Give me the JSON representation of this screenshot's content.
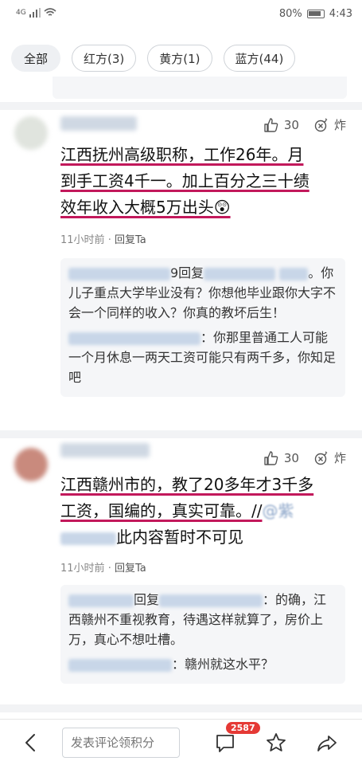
{
  "status_bar": {
    "network": "4G",
    "battery": "80%",
    "time": "4:43"
  },
  "filters": [
    {
      "label": "全部"
    },
    {
      "label": "红方(3)"
    },
    {
      "label": "黄方(1)"
    },
    {
      "label": "蓝方(44)"
    }
  ],
  "comments": [
    {
      "likes": "30",
      "bomb_label": "炸",
      "body_line1": "江西抚州高级职称，工作26年。月",
      "body_line2": "到手工资4千一。加上百分之三十绩",
      "body_line3": "效年收入大概5万出头😲",
      "time": "11小时前",
      "reply_label": "回复Ta",
      "replies": [
        {
          "prefix": "9回复",
          "text": "。你儿子重点大学毕业没有？你想他毕业跟你大字不会一个同样的收入？你真的教坏后生！"
        },
        {
          "prefix": "",
          "text": "：你那里普通工人可能一个月休息一两天工资可能只有两千多，你知足吧"
        }
      ]
    },
    {
      "likes": "30",
      "bomb_label": "炸",
      "body_line1": "江西赣州市的，教了20多年才3千多",
      "body_line2": "工资，国编的，真实可靠。//",
      "body_line3": "此内容暂时不可见",
      "mention": "@紫",
      "time": "11小时前",
      "reply_label": "回复Ta",
      "replies": [
        {
          "prefix": "回复",
          "text": "：的确，江西赣州不重视教育，待遇这样就算了，房价上万，真心不想吐槽。"
        },
        {
          "prefix": "",
          "text": "：赣州就这水平？"
        }
      ]
    }
  ],
  "bottom_bar": {
    "input_placeholder": "发表评论领积分",
    "comment_count": "2587"
  },
  "colors": {
    "underline": "#c2185b",
    "badge": "#e53935",
    "panel": "#f5f6f8"
  }
}
